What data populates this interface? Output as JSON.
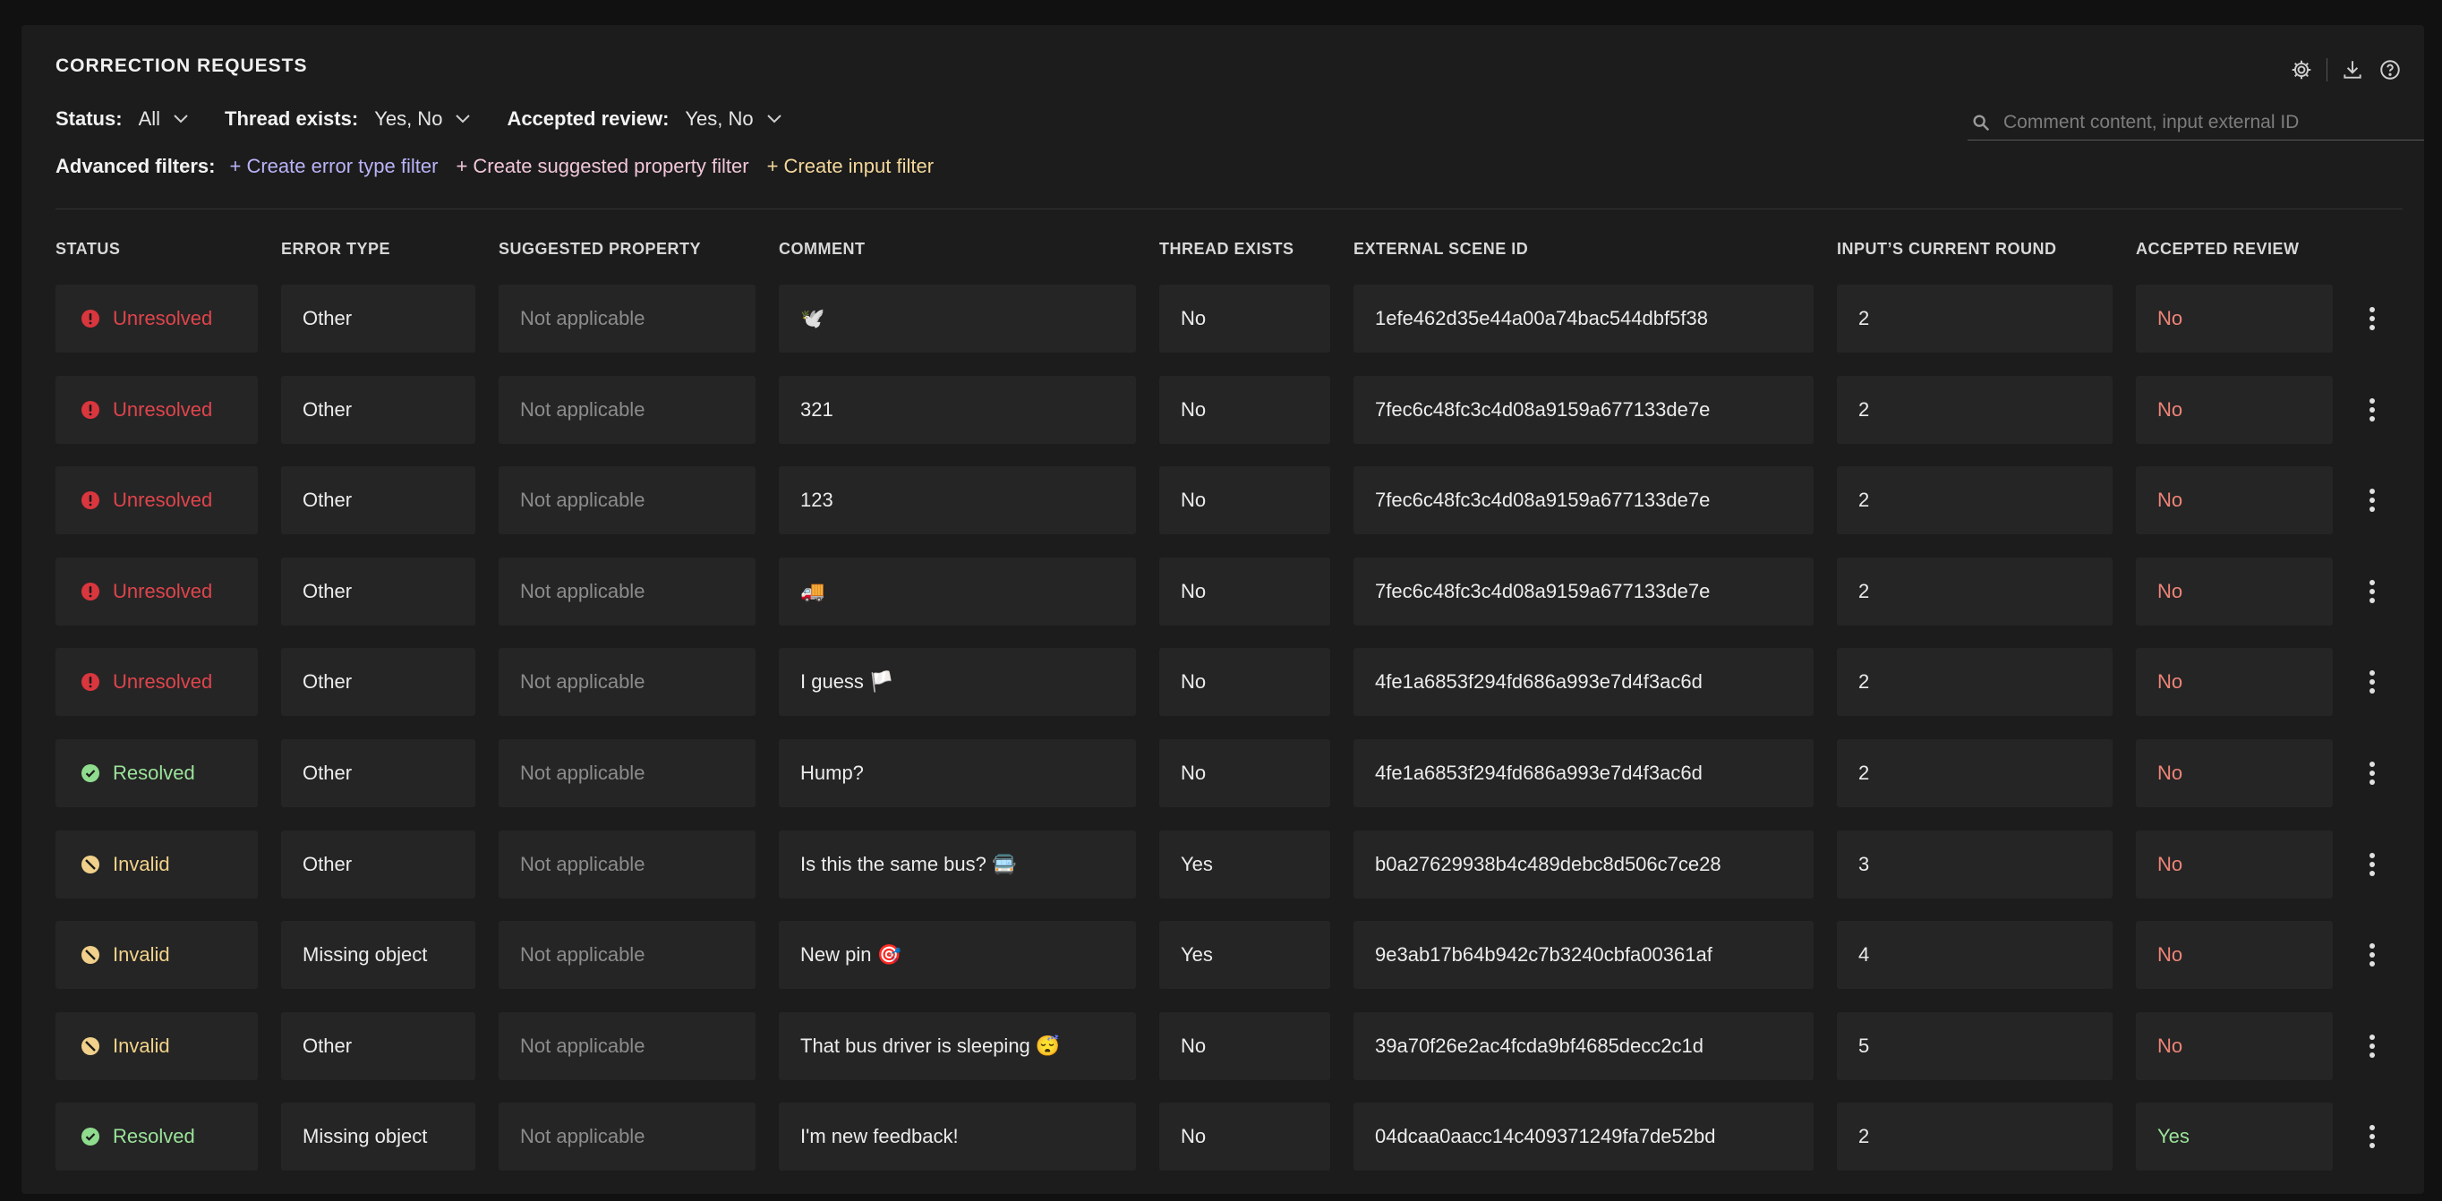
{
  "header": {
    "title": "CORRECTION REQUESTS"
  },
  "filters": {
    "status_label": "Status:",
    "status_value": "All",
    "thread_label": "Thread exists:",
    "thread_value": "Yes, No",
    "accepted_label": "Accepted review:",
    "accepted_value": "Yes, No"
  },
  "search": {
    "placeholder": "Comment content, input external ID"
  },
  "advanced": {
    "label": "Advanced filters:",
    "error_type": "+ Create error type filter",
    "suggested_property": "+ Create suggested property filter",
    "input": "+ Create input filter"
  },
  "columns": {
    "status": "STATUS",
    "error_type": "ERROR TYPE",
    "suggested_property": "SUGGESTED PROPERTY",
    "comment": "COMMENT",
    "thread_exists": "THREAD EXISTS",
    "external_scene_id": "EXTERNAL SCENE ID",
    "current_round": "INPUT’S CURRENT ROUND",
    "accepted_review": "ACCEPTED REVIEW"
  },
  "colors": {
    "unresolved": "#e0444c",
    "resolved": "#9be39a",
    "invalid": "#f2d28a",
    "no": "#f08478",
    "yes": "#9be39a"
  },
  "rows": [
    {
      "status": "Unresolved",
      "status_icon": "error-icon",
      "error_type": "Other",
      "suggested_property": "Not applicable",
      "comment": "🕊️",
      "thread_exists": "No",
      "external_scene_id": "1efe462d35e44a00a74bac544dbf5f38",
      "current_round": "2",
      "accepted_review": "No"
    },
    {
      "status": "Unresolved",
      "status_icon": "error-icon",
      "error_type": "Other",
      "suggested_property": "Not applicable",
      "comment": "321",
      "thread_exists": "No",
      "external_scene_id": "7fec6c48fc3c4d08a9159a677133de7e",
      "current_round": "2",
      "accepted_review": "No"
    },
    {
      "status": "Unresolved",
      "status_icon": "error-icon",
      "error_type": "Other",
      "suggested_property": "Not applicable",
      "comment": "123",
      "thread_exists": "No",
      "external_scene_id": "7fec6c48fc3c4d08a9159a677133de7e",
      "current_round": "2",
      "accepted_review": "No"
    },
    {
      "status": "Unresolved",
      "status_icon": "error-icon",
      "error_type": "Other",
      "suggested_property": "Not applicable",
      "comment": "🚚",
      "thread_exists": "No",
      "external_scene_id": "7fec6c48fc3c4d08a9159a677133de7e",
      "current_round": "2",
      "accepted_review": "No"
    },
    {
      "status": "Unresolved",
      "status_icon": "error-icon",
      "error_type": "Other",
      "suggested_property": "Not applicable",
      "comment": "I guess 🏳️",
      "thread_exists": "No",
      "external_scene_id": "4fe1a6853f294fd686a993e7d4f3ac6d",
      "current_round": "2",
      "accepted_review": "No"
    },
    {
      "status": "Resolved",
      "status_icon": "check-icon",
      "error_type": "Other",
      "suggested_property": "Not applicable",
      "comment": "Hump?",
      "thread_exists": "No",
      "external_scene_id": "4fe1a6853f294fd686a993e7d4f3ac6d",
      "current_round": "2",
      "accepted_review": "No"
    },
    {
      "status": "Invalid",
      "status_icon": "invalid-icon",
      "error_type": "Other",
      "suggested_property": "Not applicable",
      "comment": "Is this the same bus? 🚍",
      "thread_exists": "Yes",
      "external_scene_id": "b0a27629938b4c489debc8d506c7ce28",
      "current_round": "3",
      "accepted_review": "No"
    },
    {
      "status": "Invalid",
      "status_icon": "invalid-icon",
      "error_type": "Missing object",
      "suggested_property": "Not applicable",
      "comment": "New pin 🎯",
      "thread_exists": "Yes",
      "external_scene_id": "9e3ab17b64b942c7b3240cbfa00361af",
      "current_round": "4",
      "accepted_review": "No"
    },
    {
      "status": "Invalid",
      "status_icon": "invalid-icon",
      "error_type": "Other",
      "suggested_property": "Not applicable",
      "comment": "That bus driver is sleeping 😴",
      "thread_exists": "No",
      "external_scene_id": "39a70f26e2ac4fcda9bf4685decc2c1d",
      "current_round": "5",
      "accepted_review": "No"
    },
    {
      "status": "Resolved",
      "status_icon": "check-icon",
      "error_type": "Missing object",
      "suggested_property": "Not applicable",
      "comment": "I'm new feedback!",
      "thread_exists": "No",
      "external_scene_id": "04dcaa0aacc14c409371249fa7de52bd",
      "current_round": "2",
      "accepted_review": "Yes"
    }
  ]
}
